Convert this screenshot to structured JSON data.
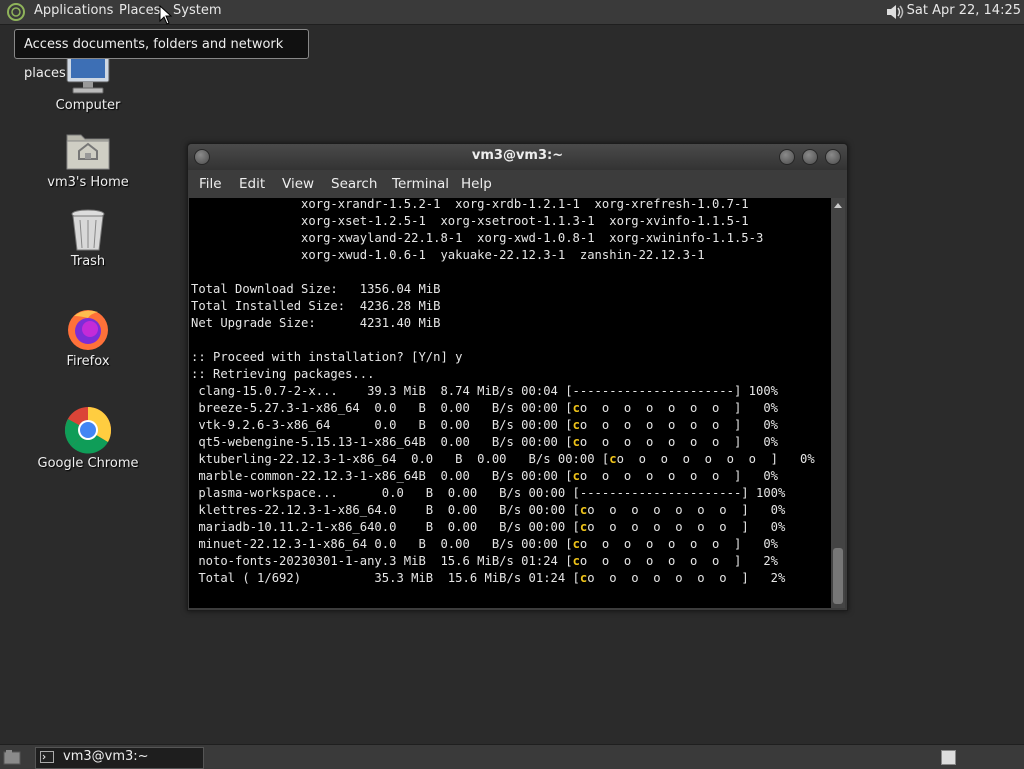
{
  "top_panel": {
    "menu_applications": "Applications",
    "menu_places": "Places",
    "menu_system": "System",
    "clock": "Sat Apr 22, 14:25"
  },
  "tooltip": "Access documents, folders and network places",
  "desktop_icons": {
    "computer": "Computer",
    "home": "vm3's Home",
    "trash": "Trash",
    "firefox": "Firefox",
    "chrome": "Google Chrome"
  },
  "terminal": {
    "title": "vm3@vm3:~",
    "menu": {
      "file": "File",
      "edit": "Edit",
      "view": "View",
      "search": "Search",
      "terminal": "Terminal",
      "help": "Help"
    },
    "lines": [
      "               xorg-xrandr-1.5.2-1  xorg-xrdb-1.2.1-1  xorg-xrefresh-1.0.7-1",
      "               xorg-xset-1.2.5-1  xorg-xsetroot-1.1.3-1  xorg-xvinfo-1.1.5-1",
      "               xorg-xwayland-22.1.8-1  xorg-xwd-1.0.8-1  xorg-xwininfo-1.1.5-3",
      "               xorg-xwud-1.0.6-1  yakuake-22.12.3-1  zanshin-22.12.3-1",
      "",
      "Total Download Size:   1356.04 MiB",
      "Total Installed Size:  4236.28 MiB",
      "Net Upgrade Size:      4231.40 MiB",
      "",
      ":: Proceed with installation? [Y/n] y",
      ":: Retrieving packages...",
      " clang-15.0.7-2-x...    39.3 MiB  8.74 MiB/s 00:04 [----------------------] 100%",
      " breeze-5.27.3-1-x86_64  0.0   B  0.00   B/s 00:00 [co  o  o  o  o  o  o  ]   0%",
      " vtk-9.2.6-3-x86_64      0.0   B  0.00   B/s 00:00 [co  o  o  o  o  o  o  ]   0%",
      " qt5-webengine-5.15.13-1-x86_64B  0.00   B/s 00:00 [co  o  o  o  o  o  o  ]   0%",
      " ktuberling-22.12.3-1-x86_64  0.0   B  0.00   B/s 00:00 [co  o  o  o  o  o  o  ]   0%",
      " marble-common-22.12.3-1-x86_64B  0.00   B/s 00:00 [co  o  o  o  o  o  o  ]   0%",
      " plasma-workspace...      0.0   B  0.00   B/s 00:00 [----------------------] 100%",
      " klettres-22.12.3-1-x86_64.0    B  0.00   B/s 00:00 [co  o  o  o  o  o  o  ]   0%",
      " mariadb-10.11.2-1-x86_640.0    B  0.00   B/s 00:00 [co  o  o  o  o  o  o  ]   0%",
      " minuet-22.12.3-1-x86_64 0.0   B  0.00   B/s 00:00 [co  o  o  o  o  o  o  ]   0%",
      " noto-fonts-20230301-1-any.3 MiB  15.6 MiB/s 01:24 [co  o  o  o  o  o  o  ]   2%",
      " Total ( 1/692)          35.3 MiB  15.6 MiB/s 01:24 [co  o  o  o  o  o  o  ]   2%"
    ]
  },
  "taskbar": {
    "task_label": "vm3@vm3:~"
  },
  "colors": {
    "pacman_highlight": "#f0c419",
    "terminal_bg": "#000000",
    "panel_bg": "#3a3a3a",
    "desktop_bg": "#2b2b2b"
  }
}
